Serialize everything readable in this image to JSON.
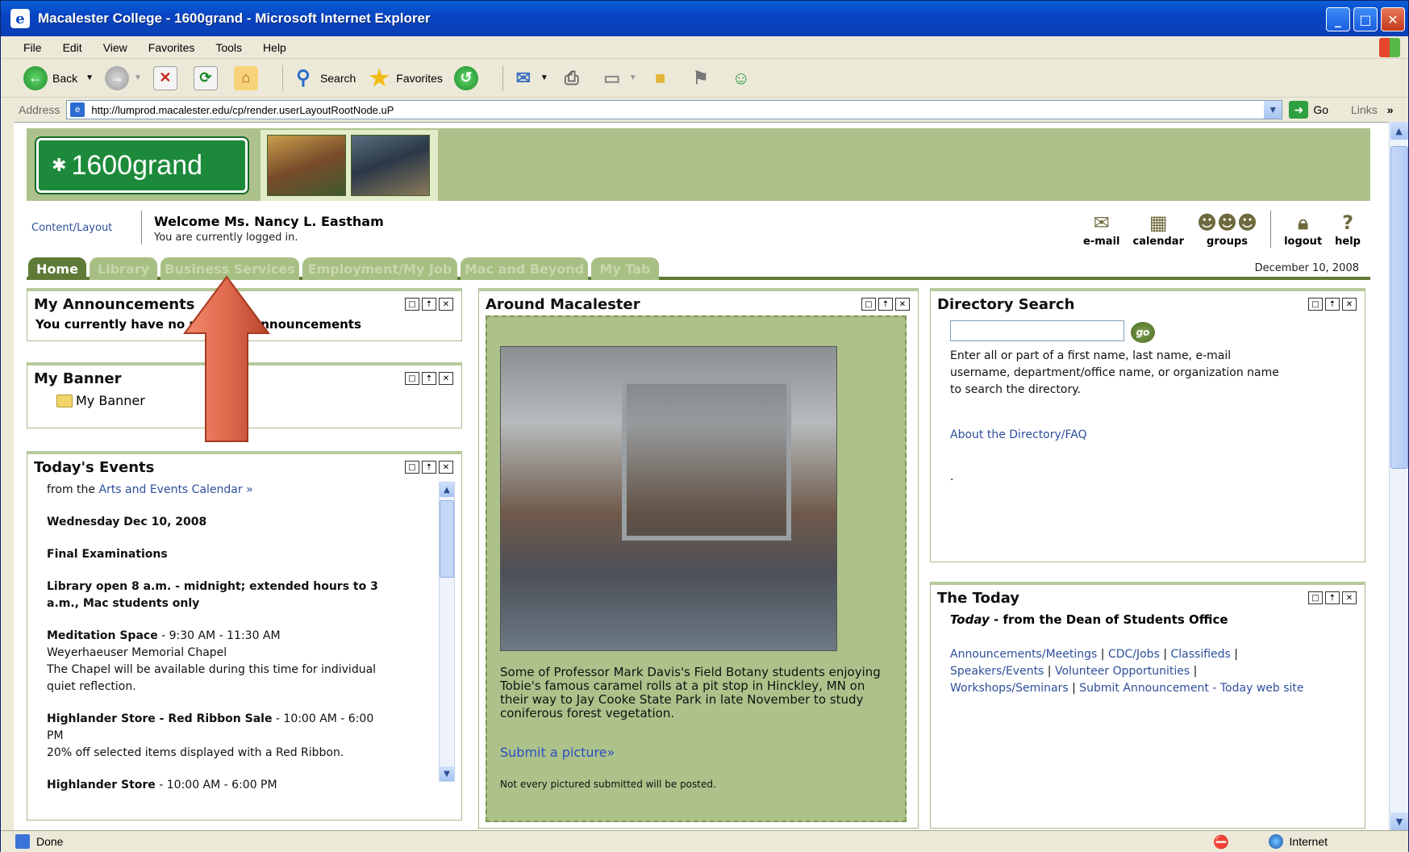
{
  "window": {
    "title": "Macalester College - 1600grand - Microsoft Internet Explorer"
  },
  "menu": [
    "File",
    "Edit",
    "View",
    "Favorites",
    "Tools",
    "Help"
  ],
  "toolbar": {
    "back": "Back",
    "search": "Search",
    "favorites": "Favorites"
  },
  "address": {
    "label": "Address",
    "url": "http://lumprod.macalester.edu/cp/render.userLayoutRootNode.uP",
    "go": "Go",
    "links": "Links"
  },
  "status": {
    "text": "Done",
    "zone": "Internet"
  },
  "header": {
    "logo_text": "1600grand"
  },
  "welcome": {
    "content_layout": "Content/Layout",
    "greeting": "Welcome Ms. Nancy L. Eastham",
    "logged_in": "You are currently logged in."
  },
  "tools": [
    {
      "label": "e-mail",
      "icon": "envelope-icon"
    },
    {
      "label": "calendar",
      "icon": "calendar-icon"
    },
    {
      "label": "groups",
      "icon": "groups-icon"
    },
    {
      "label": "logout",
      "icon": "lock-icon"
    },
    {
      "label": "help",
      "icon": "question-icon"
    }
  ],
  "tabs": [
    "Home",
    "Library",
    "Business Services",
    "Employment/My Job",
    "Mac and Beyond",
    "My Tab"
  ],
  "date": "December 10, 2008",
  "announcements": {
    "title": "My Announcements",
    "text": "You currently have no personal announcements"
  },
  "banner": {
    "title": "My Banner",
    "item": "My Banner"
  },
  "events": {
    "title": "Today's Events",
    "from_prefix": "from the",
    "calendar_link": "Arts and Events Calendar »",
    "date": "Wednesday Dec 10, 2008",
    "items": [
      {
        "heading": "Final Examinations"
      },
      {
        "heading": "Library open 8 a.m. - midnight; extended hours to 3 a.m., Mac students only"
      },
      {
        "heading": "Meditation Space",
        "time": " - 9:30 AM  - 11:30 AM",
        "place": "Weyerhaeuser Memorial Chapel",
        "desc": "The Chapel will be available during this time for individual quiet reflection."
      },
      {
        "heading": "Highlander Store - Red Ribbon Sale",
        "time": " - 10:00 AM  - 6:00 PM",
        "desc": "20% off selected items displayed with a Red Ribbon."
      },
      {
        "heading": "Highlander Store",
        "time": " - 10:00 AM  - 6:00 PM"
      }
    ]
  },
  "around": {
    "title": "Around Macalester",
    "caption": "Some of Professor Mark Davis's Field Botany students enjoying Tobie's famous caramel rolls at a pit stop in Hinckley, MN on their way to Jay Cooke State Park in late November to study coniferous forest vegetation.",
    "submit": "Submit a picture»",
    "notice": "Not every pictured submitted will be posted."
  },
  "directory": {
    "title": "Directory Search",
    "go": "go",
    "help": "Enter all or part of a first name, last name, e-mail username, department/office name, or organization name to search the directory.",
    "faq": "About the Directory/FAQ",
    "dot": "."
  },
  "today": {
    "title": "The Today",
    "sub_italic": "Today",
    "sub_rest": " - from the Dean of Students Office",
    "links": [
      "Announcements/Meetings",
      "CDC/Jobs",
      "Classifieds",
      "Speakers/Events",
      "Volunteer Opportunities",
      "Workshops/Seminars",
      "Submit Announcement - Today web site"
    ]
  },
  "colors": {
    "header_green": "#adc28a",
    "tab_active": "#5e7a36",
    "arrow_red": "#e06a4e"
  }
}
